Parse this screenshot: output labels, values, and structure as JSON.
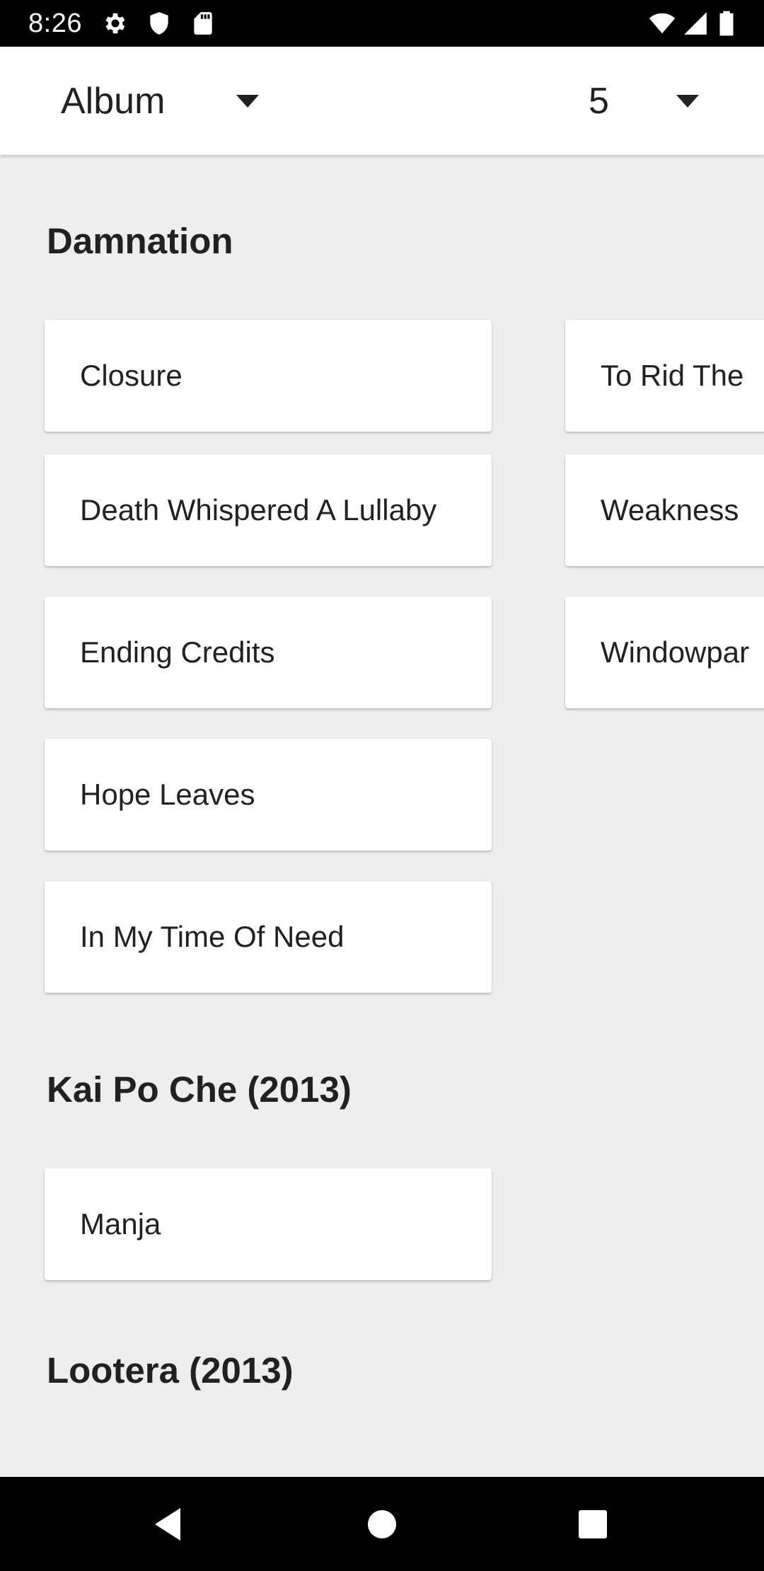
{
  "status_bar": {
    "time": "8:26",
    "left_icons": [
      "gear-icon",
      "shield-icon",
      "sd-card-icon"
    ],
    "right_icons": [
      "wifi-icon",
      "signal-icon",
      "battery-icon"
    ]
  },
  "toolbar": {
    "group_by": {
      "selected": "Album"
    },
    "count": {
      "selected": "5"
    }
  },
  "sections": [
    {
      "title": "Damnation",
      "tracks_left": [
        "Closure",
        "Death Whispered A Lullaby",
        "Ending Credits",
        "Hope Leaves",
        "In My Time Of Need"
      ],
      "tracks_right": [
        "To Rid The",
        "Weakness",
        "Windowpar"
      ]
    },
    {
      "title": "Kai Po Che (2013)",
      "tracks_left": [
        "Manja"
      ]
    },
    {
      "title": "Lootera (2013)"
    }
  ],
  "nav_bar": {
    "buttons": [
      "back-icon",
      "home-icon",
      "recents-icon"
    ]
  },
  "colors": {
    "background": "#eeeeee",
    "surface": "#ffffff",
    "text": "#212121",
    "system_bars": "#000000"
  }
}
